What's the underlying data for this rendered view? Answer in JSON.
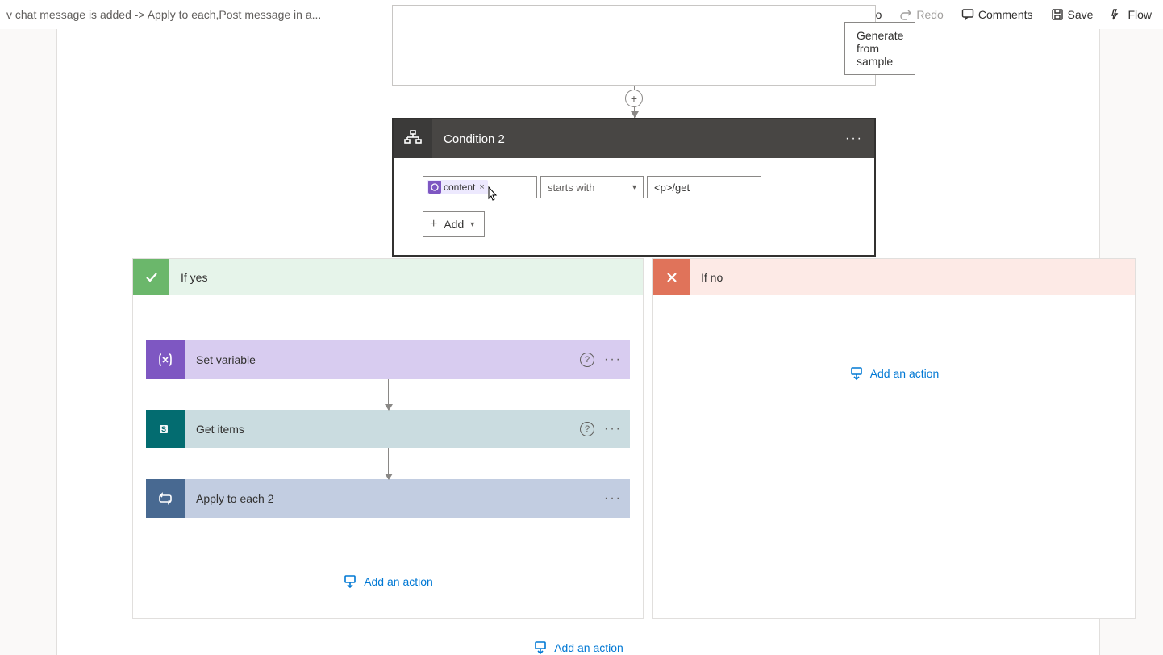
{
  "topbar": {
    "breadcrumb": "v chat message is added -> Apply to each,Post message in a...",
    "undo": "Undo",
    "redo": "Redo",
    "comments": "Comments",
    "save": "Save",
    "flow": "Flow"
  },
  "prev": {
    "generate_btn": "Generate from sample"
  },
  "condition": {
    "title": "Condition 2",
    "token_label": "content",
    "operator": "starts with",
    "value": "<p>/get",
    "add_label": "Add"
  },
  "branches": {
    "yes": {
      "title": "If yes",
      "actions": [
        {
          "title": "Set variable",
          "type": "purple",
          "icon": "var",
          "help": true
        },
        {
          "title": "Get items",
          "type": "teal",
          "icon": "sp",
          "help": true
        },
        {
          "title": "Apply to each 2",
          "type": "blue",
          "icon": "loop",
          "help": false
        }
      ],
      "add_action": "Add an action"
    },
    "no": {
      "title": "If no",
      "add_action": "Add an action"
    }
  },
  "bottom": {
    "add_action": "Add an action"
  }
}
